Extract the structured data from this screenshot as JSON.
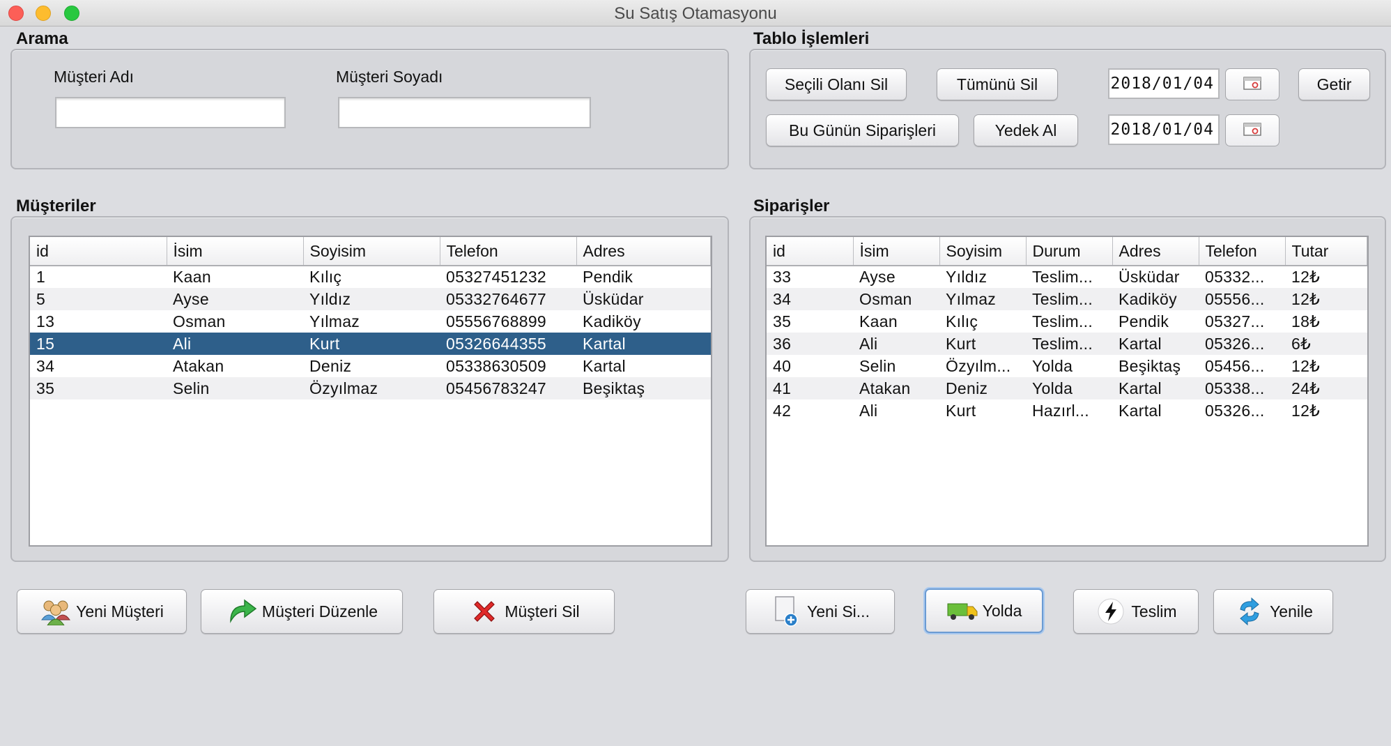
{
  "window": {
    "title": "Su Satış Otamasyonu"
  },
  "search": {
    "section_label": "Arama",
    "first_name_label": "Müşteri Adı",
    "last_name_label": "Müşteri Soyadı",
    "first_name_value": "",
    "last_name_value": ""
  },
  "table_ops": {
    "section_label": "Tablo İşlemleri",
    "delete_selected": "Seçili Olanı Sil",
    "delete_all": "Tümünü Sil",
    "todays_orders": "Bu Günün Siparişleri",
    "backup": "Yedek Al",
    "date1": "2018/01/04",
    "date2": "2018/01/04",
    "fetch": "Getir"
  },
  "customers": {
    "section_label": "Müşteriler",
    "columns": [
      "id",
      "İsim",
      "Soyisim",
      "Telefon",
      "Adres"
    ],
    "selected_index": 3,
    "rows": [
      [
        "1",
        "Kaan",
        "Kılıç",
        "05327451232",
        "Pendik"
      ],
      [
        "5",
        "Ayse",
        "Yıldız",
        "05332764677",
        "Üsküdar"
      ],
      [
        "13",
        "Osman",
        "Yılmaz",
        "05556768899",
        "Kadiköy"
      ],
      [
        "15",
        "Ali",
        "Kurt",
        "05326644355",
        "Kartal"
      ],
      [
        "34",
        "Atakan",
        "Deniz",
        "05338630509",
        "Kartal"
      ],
      [
        "35",
        "Selin",
        "Özyılmaz",
        "05456783247",
        "Beşiktaş"
      ]
    ]
  },
  "orders": {
    "section_label": "Siparişler",
    "columns": [
      "id",
      "İsim",
      "Soyisim",
      "Durum",
      "Adres",
      "Telefon",
      "Tutar"
    ],
    "rows": [
      [
        "33",
        "Ayse",
        "Yıldız",
        "Teslim...",
        "Üsküdar",
        "05332...",
        "12₺"
      ],
      [
        "34",
        "Osman",
        "Yılmaz",
        "Teslim...",
        "Kadiköy",
        "05556...",
        "12₺"
      ],
      [
        "35",
        "Kaan",
        "Kılıç",
        "Teslim...",
        "Pendik",
        "05327...",
        "18₺"
      ],
      [
        "36",
        "Ali",
        "Kurt",
        "Teslim...",
        "Kartal",
        "05326...",
        "6₺"
      ],
      [
        "40",
        "Selin",
        "Özyılm...",
        "Yolda",
        "Beşiktaş",
        "05456...",
        "12₺"
      ],
      [
        "41",
        "Atakan",
        "Deniz",
        "Yolda",
        "Kartal",
        "05338...",
        "24₺"
      ],
      [
        "42",
        "Ali",
        "Kurt",
        "Hazırl...",
        "Kartal",
        "05326...",
        "12₺"
      ]
    ]
  },
  "actions": {
    "new_customer": "Yeni Müşteri",
    "edit_customer": "Müşteri Düzenle",
    "delete_customer": "Müşteri Sil",
    "new_order": "Yeni Si...",
    "on_the_way": "Yolda",
    "delivered": "Teslim",
    "refresh": "Yenile"
  },
  "icons": {
    "new_customer": "users-icon",
    "edit_customer": "green-curved-arrow-icon",
    "delete_customer": "red-x-icon",
    "new_order": "document-add-icon",
    "on_the_way": "truck-icon",
    "delivered": "lightning-icon",
    "refresh": "refresh-icon",
    "calendar": "calendar-icon"
  },
  "colors": {
    "selection": "#2e5f8a",
    "window_bg": "#dcdde1"
  }
}
